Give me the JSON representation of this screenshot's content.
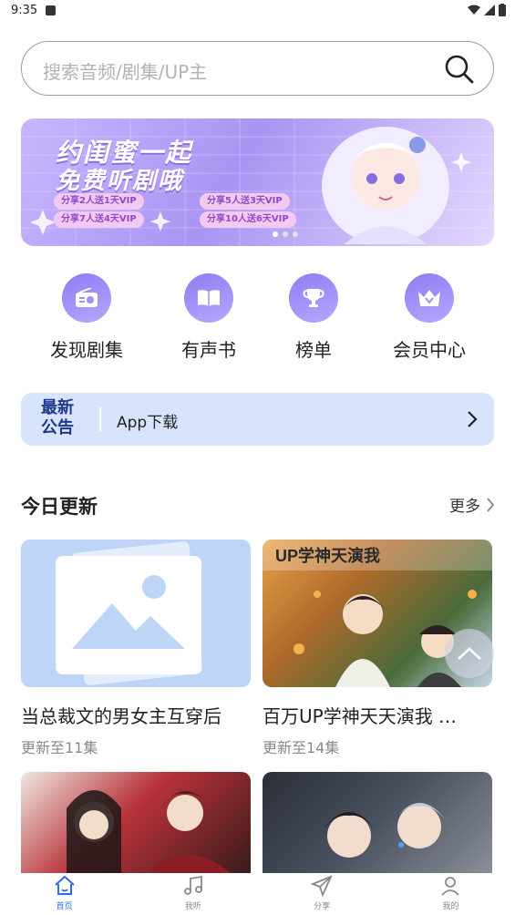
{
  "status": {
    "time": "9:35"
  },
  "search": {
    "placeholder": "搜索音频/剧集/UP主"
  },
  "banner": {
    "title1": "约闺蜜一起",
    "title2": "免费听剧哦",
    "pills": [
      "分享2人送1天VIP",
      "分享5人送3天VIP",
      "分享7人送4天VIP",
      "分享10人送6天VIP"
    ]
  },
  "quick": [
    {
      "label": "发现剧集",
      "icon": "radio-icon"
    },
    {
      "label": "有声书",
      "icon": "book-icon"
    },
    {
      "label": "榜单",
      "icon": "trophy-icon"
    },
    {
      "label": "会员中心",
      "icon": "crown-icon"
    }
  ],
  "notice": {
    "tag_line1": "最新",
    "tag_line2": "公告",
    "text": "App下载"
  },
  "section": {
    "title": "今日更新",
    "more": "更多"
  },
  "cards": [
    {
      "title": "当总裁文的男女主互穿后",
      "sub": "更新至11集"
    },
    {
      "title": "百万UP学神天天演我 …",
      "sub": "更新至14集"
    },
    {
      "title": "",
      "sub": ""
    },
    {
      "title": "",
      "sub": ""
    }
  ],
  "nav": [
    {
      "label": "首页",
      "icon": "home-icon",
      "active": true
    },
    {
      "label": "我听",
      "icon": "music-note-icon"
    },
    {
      "label": "分享",
      "icon": "paper-plane-icon"
    },
    {
      "label": "我的",
      "icon": "user-icon"
    }
  ],
  "colors": {
    "accent": "#2f6bf1",
    "icon_purple": "#8d7df2",
    "notice_bg": "#d8e4fb"
  }
}
